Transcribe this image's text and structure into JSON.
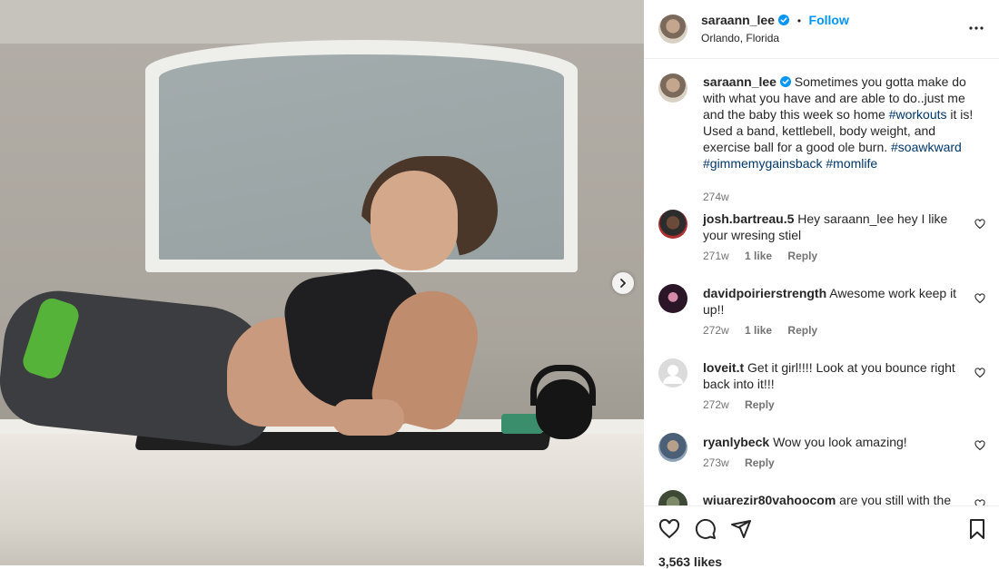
{
  "post": {
    "owner": {
      "username": "saraann_lee",
      "location": "Orlando, Florida",
      "follow_label": "Follow",
      "separator": "•"
    },
    "caption": {
      "username": "saraann_lee",
      "text_before": "Sometimes you gotta make do with what you have and are able to do..just me and the baby this week so home ",
      "hashtag_1": "#workouts",
      "text_middle": " it is! Used a band, kettlebell, body weight, and exercise ball for a good ole burn. ",
      "hashtag_2": "#soawkward",
      "hashtag_3": "#gimmemygainsback",
      "hashtag_4": "#momlife",
      "time": "274w"
    },
    "comments": [
      {
        "username": "josh.bartreau.5",
        "text": "Hey saraann_lee hey I like your wresing stiel",
        "time": "271w",
        "likes": "1 like",
        "reply": "Reply"
      },
      {
        "username": "davidpoirierstrength",
        "text": "Awesome work keep it up!!",
        "time": "272w",
        "likes": "1 like",
        "reply": "Reply"
      },
      {
        "username": "loveit.t",
        "text": "Get it girl!!!! Look at you bounce right back into it!!!",
        "time": "272w",
        "reply": "Reply"
      },
      {
        "username": "ryanlybeck",
        "text": "Wow you look amazing!",
        "time": "273w",
        "reply": "Reply"
      },
      {
        "username": "wiuarezir80vahoocom",
        "text": "are you still with the"
      }
    ],
    "likes_count": "3,563 likes"
  },
  "icons": {
    "verified": "verified-badge-icon",
    "more": "more-options-icon",
    "like": "heart-icon",
    "comment": "comment-icon",
    "share": "share-icon",
    "save": "bookmark-icon",
    "next": "chevron-right-icon"
  },
  "colors": {
    "accent": "#0095f6",
    "hashtag": "#00376b",
    "muted": "#737373",
    "band": "#56b33a"
  }
}
